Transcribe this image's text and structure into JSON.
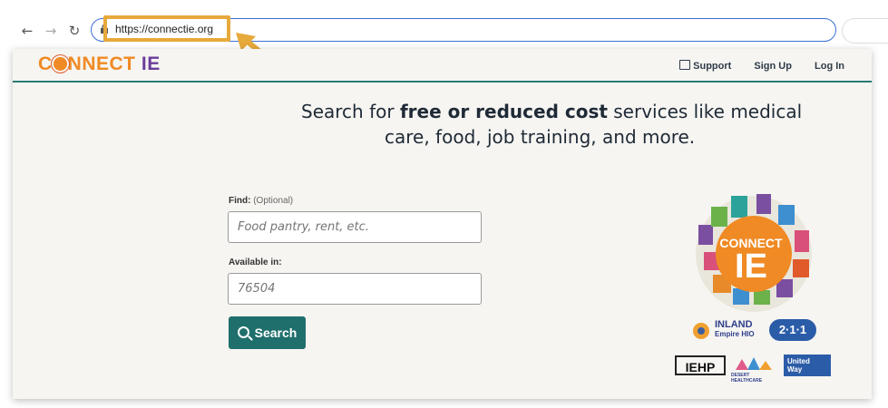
{
  "browser": {
    "url": "https://connectie.org",
    "icons": [
      "back-arrow-icon",
      "forward-arrow-icon",
      "reload-icon",
      "lock-icon",
      "share-icon",
      "star-icon"
    ]
  },
  "site": {
    "brand_part1": "C",
    "brand_part2": "NNECT",
    "brand_part3": "IE",
    "nav": {
      "support": "Support",
      "signup": "Sign Up",
      "login": "Log In"
    }
  },
  "hero": {
    "line1_pre": "Search for ",
    "line1_bold": "free or reduced cost",
    "line1_post": " services like medical",
    "line2": "care, food, job training, and more."
  },
  "form": {
    "find_label": "Find:",
    "find_optional": "(Optional)",
    "find_placeholder": "Food pantry, rent, etc.",
    "available_label": "Available in:",
    "available_value": "76504",
    "search_label": "Search"
  },
  "badge": {
    "line1": "CONNECT",
    "line2": "IE"
  },
  "partners": {
    "inland_hio_line1": "INLAND",
    "inland_hio_line2": "Empire HIO",
    "two11": "2·1·1",
    "iehp": "IEHP",
    "desert": "DESERT HEALTHCARE",
    "united_way_line1": "United",
    "united_way_line2": "Way"
  },
  "colors": {
    "accent_teal": "#1f6f6c",
    "brand_orange": "#f08a24",
    "brand_purple": "#6a3d9a",
    "highlight": "#e7a93b"
  }
}
